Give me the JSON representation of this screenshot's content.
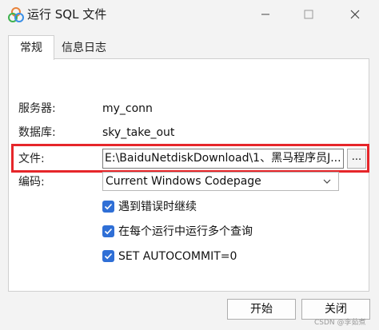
{
  "window": {
    "title": "运行 SQL 文件",
    "app_icon": "navicat-logo-icon",
    "controls": [
      "minimize-icon",
      "maximize-icon",
      "close-icon"
    ]
  },
  "tabs": [
    {
      "label": "常规",
      "active": true
    },
    {
      "label": "信息日志",
      "active": false
    }
  ],
  "form": {
    "server_label": "服务器:",
    "server_value": "my_conn",
    "database_label": "数据库:",
    "database_value": "sky_take_out",
    "file_label": "文件:",
    "file_value": "E:\\BaiduNetdiskDownload\\1、黑马程序员J...",
    "browse_label": "...",
    "encoding_label": "编码:",
    "encoding_value": "Current Windows Codepage"
  },
  "options": [
    {
      "label": "遇到错误时继续",
      "checked": true
    },
    {
      "label": "在每个运行中运行多个查询",
      "checked": true
    },
    {
      "label": "SET AUTOCOMMIT=0",
      "checked": true
    }
  ],
  "buttons": {
    "start_label": "开始",
    "close_label": "关闭"
  },
  "highlight_color": "#e6262a",
  "accent_color": "#2f6fd6",
  "watermark": "CSDN @李茹煮"
}
